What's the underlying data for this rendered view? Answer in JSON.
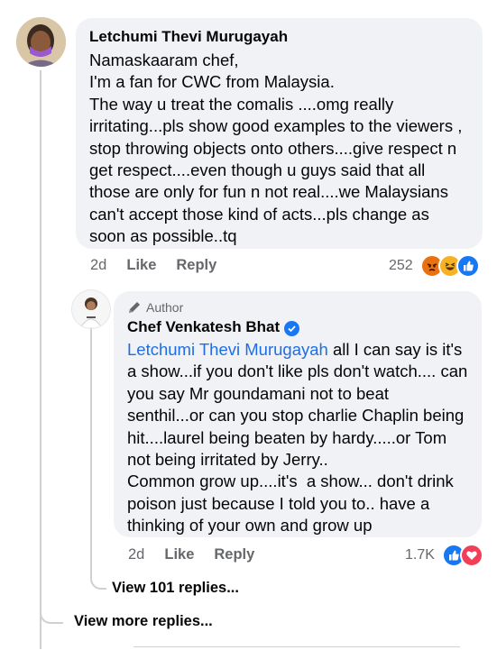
{
  "comment": {
    "author": "Letchumi Thevi Murugayah",
    "text": "Namaskaaram chef,\nI'm a fan for CWC from Malaysia.\nThe way u treat the comalis ....omg really irritating...pls show good examples to the viewers , stop throwing objects onto others....give respect n get respect....even though u guys said that all those are only for fun n not real....we Malaysians can't accept those kind of acts...pls change as soon as possible..tq",
    "time": "2d",
    "like_label": "Like",
    "reply_label": "Reply",
    "reaction_count": "252",
    "reactions": [
      "angry-icon",
      "haha-icon",
      "like-icon"
    ]
  },
  "reply": {
    "badge": "Author",
    "author": "Chef Venkatesh Bhat",
    "mention": "Letchumi Thevi Murugayah",
    "text": " all I can say is it's a show...if you don't like pls don't watch.... can you say Mr goundamani not to beat senthil...or can you stop charlie Chaplin being hit....laurel being beaten by hardy.....or Tom not being irritated by Jerry..\nCommon grow up....it's  a show... don't drink poison just because I told you to.. have a thinking of your own and grow up",
    "time": "2d",
    "like_label": "Like",
    "reply_label": "Reply",
    "reaction_count": "1.7K",
    "reactions": [
      "like-icon",
      "love-icon"
    ]
  },
  "view_replies": "View 101 replies...",
  "view_more": "View more replies...",
  "colors": {
    "bubble": "#f0f2f5",
    "mention": "#1d6ee6",
    "secondary_text": "#65676b",
    "like_blue": "#1877f2",
    "love_red": "#f33e58",
    "angry_orange": "#e9710f",
    "haha_yellow": "#f7b125"
  }
}
